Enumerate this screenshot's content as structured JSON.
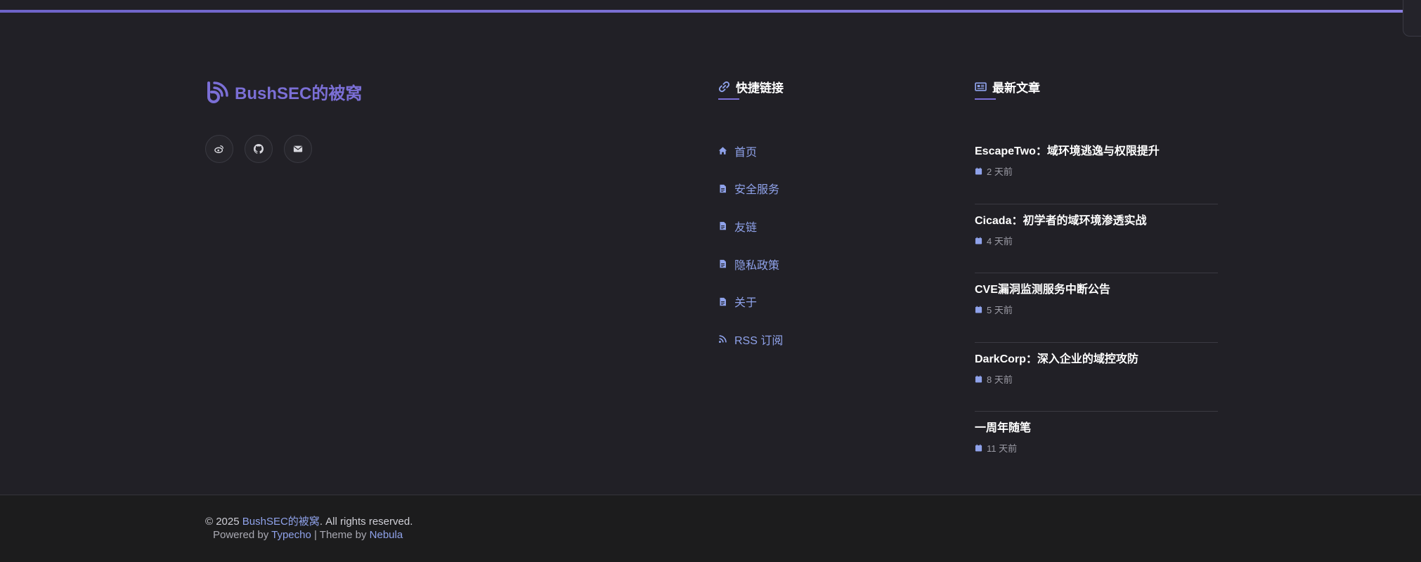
{
  "brand": {
    "name": "BushSEC的被窝",
    "accent": "#7b6fd6"
  },
  "socials": [
    {
      "icon": "weibo-icon"
    },
    {
      "icon": "github-icon"
    },
    {
      "icon": "envelope-icon"
    }
  ],
  "quick_links": {
    "title": "快捷链接",
    "items": [
      {
        "label": "首页",
        "icon": "home-icon"
      },
      {
        "label": "安全服务",
        "icon": "file-icon"
      },
      {
        "label": "友链",
        "icon": "file-icon"
      },
      {
        "label": "隐私政策",
        "icon": "file-icon"
      },
      {
        "label": "关于",
        "icon": "file-icon"
      },
      {
        "label": "RSS 订阅",
        "icon": "rss-icon"
      }
    ]
  },
  "recent_posts": {
    "title": "最新文章",
    "items": [
      {
        "title": "EscapeTwo：域环境逃逸与权限提升",
        "time": "2 天前"
      },
      {
        "title": "Cicada：初学者的域环境渗透实战",
        "time": "4 天前"
      },
      {
        "title": "CVE漏洞监测服务中断公告",
        "time": "5 天前"
      },
      {
        "title": "DarkCorp：深入企业的域控攻防",
        "time": "8 天前"
      },
      {
        "title": "一周年随笔",
        "time": "11 天前"
      }
    ]
  },
  "footer": {
    "copyright_prefix": "© 2025 ",
    "site_link": "BushSEC的被窝",
    "copyright_suffix": ". All rights reserved.",
    "powered_prefix": "Powered by ",
    "typecho": "Typecho",
    "separator": " | Theme by ",
    "theme": "Nebula"
  },
  "colors": {
    "background": "#212026",
    "link": "#8fa2ea",
    "bottom_bar": "#1c1c1d"
  }
}
